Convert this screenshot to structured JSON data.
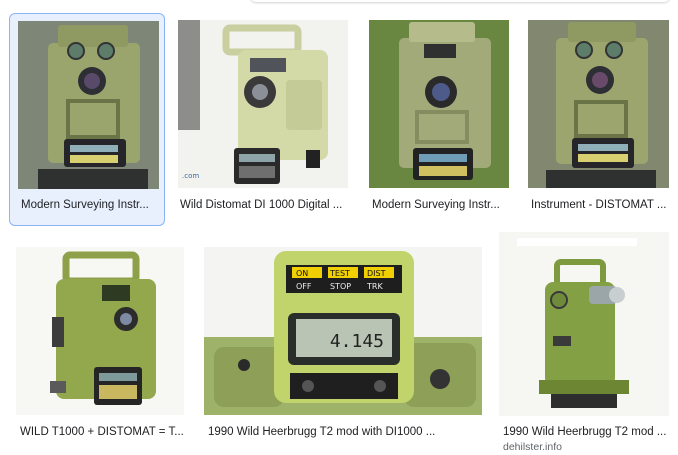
{
  "results": [
    {
      "caption": "Modern Surveying Instr...",
      "selected": true
    },
    {
      "caption": "Wild Distomat DI 1000 Digital ..."
    },
    {
      "caption": "Modern Surveying Instr..."
    },
    {
      "caption": "Instrument - DISTOMAT ..."
    },
    {
      "caption": "WILD T1000 + DISTOMAT = T..."
    },
    {
      "caption": "1990 Wild Heerbrugg T2 mod with DI1000 ..."
    },
    {
      "caption": "1990 Wild Heerbrugg T2 mod ...",
      "source": "dehilster.info"
    }
  ],
  "display_texts": {
    "on": "ON",
    "test": "TEST",
    "dist": "DIST",
    "off": "OFF",
    "stop": "STOP",
    "trk": "TRK",
    "readout": "4.145"
  },
  "colors": {
    "instrument_green": "#a9b77a",
    "instrument_dark": "#7d8a55",
    "selected_border": "#8ab4f8",
    "selected_bg": "#e8f0fe"
  }
}
